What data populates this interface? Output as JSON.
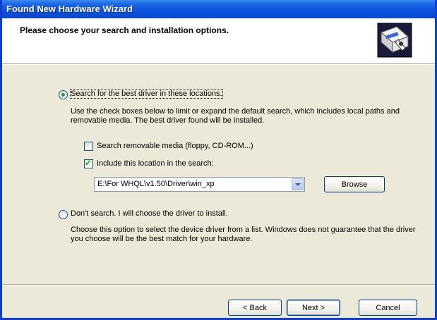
{
  "window": {
    "title": "Found New Hardware Wizard"
  },
  "header": {
    "title": "Please choose your search and installation options.",
    "icon": "hardware-wizard-icon"
  },
  "search_option": {
    "label": "Search for the best driver in these locations.",
    "selected": true,
    "description": "Use the check boxes below to limit or expand the default search, which includes local paths and removable media. The best driver found will be installed.",
    "removable_media": {
      "label": "Search removable media (floppy, CD-ROM...)",
      "checked": false
    },
    "include_location": {
      "label": "Include this location in the search:",
      "checked": true
    },
    "location_path": "E:\\For WHQL\\v1.50\\Driver\\win_xp",
    "browse_label": "Browse"
  },
  "manual_option": {
    "label": "Don't search. I will choose the driver to install.",
    "selected": false,
    "description": "Choose this option to select the device driver from a list. Windows does not guarantee that the driver you choose will be the best match for your hardware."
  },
  "footer": {
    "back_label": "< Back",
    "next_label": "Next >",
    "cancel_label": "Cancel"
  },
  "colors": {
    "title_bar": "#0a52dc",
    "dialog_bg": "#ece9d8",
    "radio_dot": "#2a9a2a",
    "check_tick": "#21a121"
  }
}
